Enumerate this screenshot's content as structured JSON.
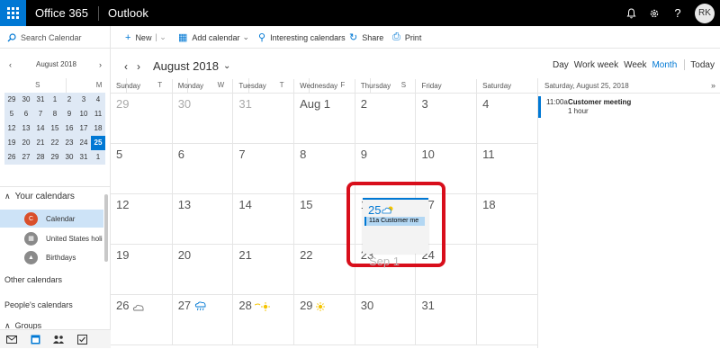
{
  "header": {
    "app_name": "Office 365",
    "app_sub": "Outlook",
    "user_initials": "RK",
    "icons": [
      "bell-icon",
      "gear-icon",
      "help-icon"
    ]
  },
  "commands": {
    "search_placeholder": "Search Calendar",
    "new_label": "New",
    "add_calendar_label": "Add calendar",
    "interesting_label": "Interesting calendars",
    "share_label": "Share",
    "print_label": "Print"
  },
  "mini_calendar": {
    "title": "August 2018",
    "weekdays": [
      "S",
      "M",
      "T",
      "W",
      "T",
      "F",
      "S"
    ],
    "weeks": [
      [
        "29",
        "30",
        "31",
        "1",
        "2",
        "3",
        "4"
      ],
      [
        "5",
        "6",
        "7",
        "8",
        "9",
        "10",
        "11"
      ],
      [
        "12",
        "13",
        "14",
        "15",
        "16",
        "17",
        "18"
      ],
      [
        "19",
        "20",
        "21",
        "22",
        "23",
        "24",
        "25"
      ],
      [
        "26",
        "27",
        "28",
        "29",
        "30",
        "31",
        "1"
      ]
    ],
    "today": "25"
  },
  "left_nav": {
    "your_calendars": "Your calendars",
    "calendars": [
      {
        "badge": "C",
        "label": "Calendar",
        "color": "#d94f2b"
      },
      {
        "badge": "",
        "label": "United States holi",
        "color": "#8a8a8a"
      },
      {
        "badge": "",
        "label": "Birthdays",
        "color": "#8a8a8a"
      }
    ],
    "other_calendars": "Other calendars",
    "peoples_calendars": "People's calendars",
    "groups": "Groups"
  },
  "main": {
    "month_title": "August 2018",
    "weekdays": [
      "Sunday",
      "Monday",
      "Tuesday",
      "Wednesday",
      "Thursday",
      "Friday",
      "Saturday"
    ],
    "weeks": [
      [
        "29",
        "30",
        "31",
        "Aug 1",
        "2",
        "3",
        "4"
      ],
      [
        "5",
        "6",
        "7",
        "8",
        "9",
        "10",
        "11"
      ],
      [
        "12",
        "13",
        "14",
        "15",
        "16",
        "17",
        "18"
      ],
      [
        "19",
        "20",
        "21",
        "22",
        "23",
        "24",
        "25"
      ],
      [
        "26",
        "27",
        "28",
        "29",
        "30",
        "31",
        "Sep 1"
      ]
    ],
    "highlight": {
      "day": "25",
      "event": "11a Customer me",
      "next": "Sep 1"
    }
  },
  "views": {
    "items": [
      "Day",
      "Work week",
      "Week",
      "Month"
    ],
    "active": "Month",
    "today": "Today"
  },
  "agenda": {
    "header": "Saturday, August 25, 2018",
    "event_time": "11:00a",
    "event_title": "Customer meeting",
    "event_duration": "1 hour"
  },
  "colors": {
    "accent": "#0078d4",
    "highlight_border": "#d80e1b"
  }
}
